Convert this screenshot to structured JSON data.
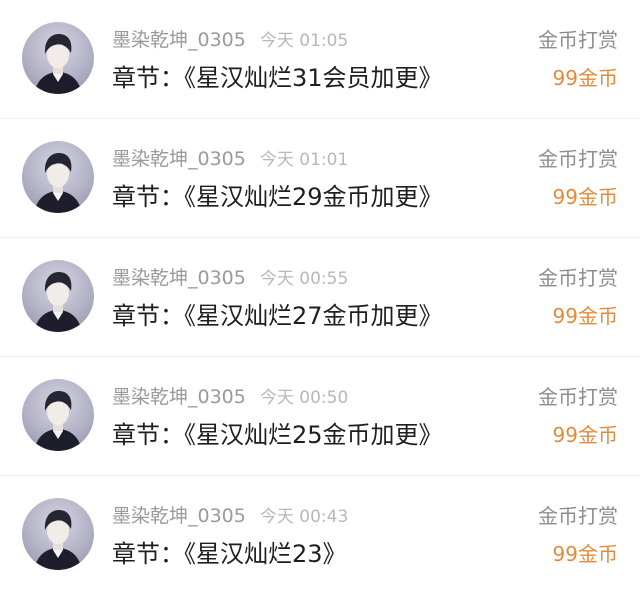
{
  "colors": {
    "background": "#ffffff",
    "username": "#9a9a9a",
    "time": "#b8b8b8",
    "chapter": "#1e1e1e",
    "reward_type": "#8d8d8d",
    "amount": "#e48a3a",
    "divider": "#f0f0f0"
  },
  "avatar_icon": "avatar-portrait-icon",
  "rows": [
    {
      "username": "墨染乾坤_0305",
      "time": "今天 01:05",
      "chapter_label": "章节：",
      "chapter_title": "《星汉灿烂31会员加更》",
      "reward_type": "金币打赏",
      "amount": "99金币"
    },
    {
      "username": "墨染乾坤_0305",
      "time": "今天 01:01",
      "chapter_label": "章节：",
      "chapter_title": "《星汉灿烂29金币加更》",
      "reward_type": "金币打赏",
      "amount": "99金币"
    },
    {
      "username": "墨染乾坤_0305",
      "time": "今天 00:55",
      "chapter_label": "章节：",
      "chapter_title": "《星汉灿烂27金币加更》",
      "reward_type": "金币打赏",
      "amount": "99金币"
    },
    {
      "username": "墨染乾坤_0305",
      "time": "今天 00:50",
      "chapter_label": "章节：",
      "chapter_title": "《星汉灿烂25金币加更》",
      "reward_type": "金币打赏",
      "amount": "99金币"
    },
    {
      "username": "墨染乾坤_0305",
      "time": "今天 00:43",
      "chapter_label": "章节：",
      "chapter_title": "《星汉灿烂23》",
      "reward_type": "金币打赏",
      "amount": "99金币"
    }
  ]
}
